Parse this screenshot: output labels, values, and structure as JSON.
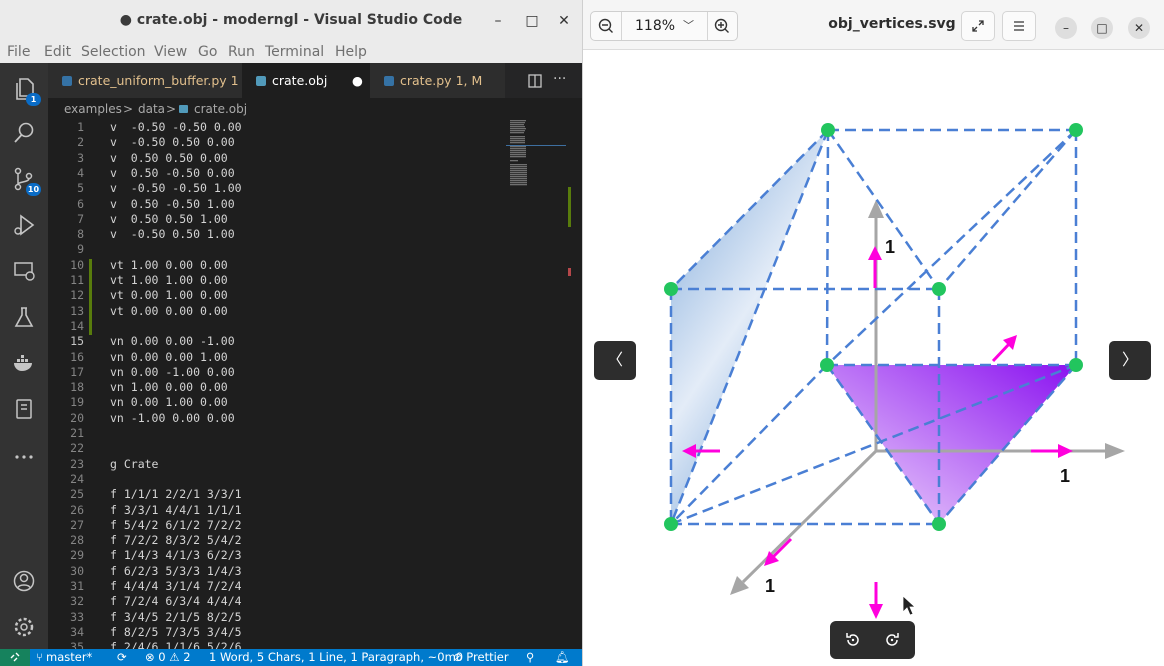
{
  "vscode": {
    "window_title": "● crate.obj - moderngl - Visual Studio Code",
    "menu": [
      "File",
      "Edit",
      "Selection",
      "View",
      "Go",
      "Run",
      "Terminal",
      "Help"
    ],
    "activity_badges": {
      "explorer": "1",
      "source_control": "10"
    },
    "tabs": [
      {
        "label": "crate_uniform_buffer.py",
        "suffix": "1",
        "color": "#e2c08d",
        "icon_color": "#3572a5"
      },
      {
        "label": "crate.obj",
        "suffix": "●",
        "color": "#ffffff",
        "icon_color": "#519aba"
      },
      {
        "label": "crate.py",
        "suffix": "1, M",
        "color": "#e2c08d",
        "icon_color": "#3572a5"
      }
    ],
    "breadcrumb": [
      "examples",
      ">",
      "data",
      ">",
      "crate.obj"
    ],
    "lines": [
      {
        "n": "1",
        "t": "v  -0.50 -0.50 0.00"
      },
      {
        "n": "2",
        "t": "v  -0.50 0.50 0.00"
      },
      {
        "n": "3",
        "t": "v  0.50 0.50 0.00"
      },
      {
        "n": "4",
        "t": "v  0.50 -0.50 0.00"
      },
      {
        "n": "5",
        "t": "v  -0.50 -0.50 1.00"
      },
      {
        "n": "6",
        "t": "v  0.50 -0.50 1.00"
      },
      {
        "n": "7",
        "t": "v  0.50 0.50 1.00"
      },
      {
        "n": "8",
        "t": "v  -0.50 0.50 1.00"
      },
      {
        "n": "9",
        "t": ""
      },
      {
        "n": "10",
        "t": "vt 1.00 0.00 0.00"
      },
      {
        "n": "11",
        "t": "vt 1.00 1.00 0.00"
      },
      {
        "n": "12",
        "t": "vt 0.00 1.00 0.00"
      },
      {
        "n": "13",
        "t": "vt 0.00 0.00 0.00"
      },
      {
        "n": "14",
        "t": ""
      },
      {
        "n": "15",
        "t": "vn 0.00 0.00 -1.00"
      },
      {
        "n": "16",
        "t": "vn 0.00 0.00 1.00"
      },
      {
        "n": "17",
        "t": "vn 0.00 -1.00 0.00"
      },
      {
        "n": "18",
        "t": "vn 1.00 0.00 0.00"
      },
      {
        "n": "19",
        "t": "vn 0.00 1.00 0.00"
      },
      {
        "n": "20",
        "t": "vn -1.00 0.00 0.00"
      },
      {
        "n": "21",
        "t": ""
      },
      {
        "n": "22",
        "t": ""
      },
      {
        "n": "23",
        "t": "g Crate"
      },
      {
        "n": "24",
        "t": ""
      },
      {
        "n": "25",
        "t": "f 1/1/1 2/2/1 3/3/1"
      },
      {
        "n": "26",
        "t": "f 3/3/1 4/4/1 1/1/1"
      },
      {
        "n": "27",
        "t": "f 5/4/2 6/1/2 7/2/2"
      },
      {
        "n": "28",
        "t": "f 7/2/2 8/3/2 5/4/2"
      },
      {
        "n": "29",
        "t": "f 1/4/3 4/1/3 6/2/3"
      },
      {
        "n": "30",
        "t": "f 6/2/3 5/3/3 1/4/3"
      },
      {
        "n": "31",
        "t": "f 4/4/4 3/1/4 7/2/4"
      },
      {
        "n": "32",
        "t": "f 7/2/4 6/3/4 4/4/4"
      },
      {
        "n": "33",
        "t": "f 3/4/5 2/1/5 8/2/5"
      },
      {
        "n": "34",
        "t": "f 8/2/5 7/3/5 3/4/5"
      },
      {
        "n": "35",
        "t": "f 2/4/6 1/1/6 5/2/6"
      }
    ],
    "status": {
      "branch": "master*",
      "sync": "⟳",
      "problems": "⊗ 0 ⚠ 2",
      "selection": "1 Word, 5 Chars, 1 Line, 1 Paragraph, ~0m0",
      "prettier": "⊘ Prettier"
    }
  },
  "viewer": {
    "zoom": "118%",
    "title": "obj_vertices.svg",
    "axis_labels": {
      "y": "1",
      "x": "1",
      "z": "1"
    },
    "colors": {
      "edge": "#4a7fd4",
      "vertex": "#22c55e",
      "normal": "#ff00dd",
      "axis": "#a6a6a6",
      "left_face": "#6f9fd6",
      "bottom_face": "#b23cf2"
    }
  }
}
